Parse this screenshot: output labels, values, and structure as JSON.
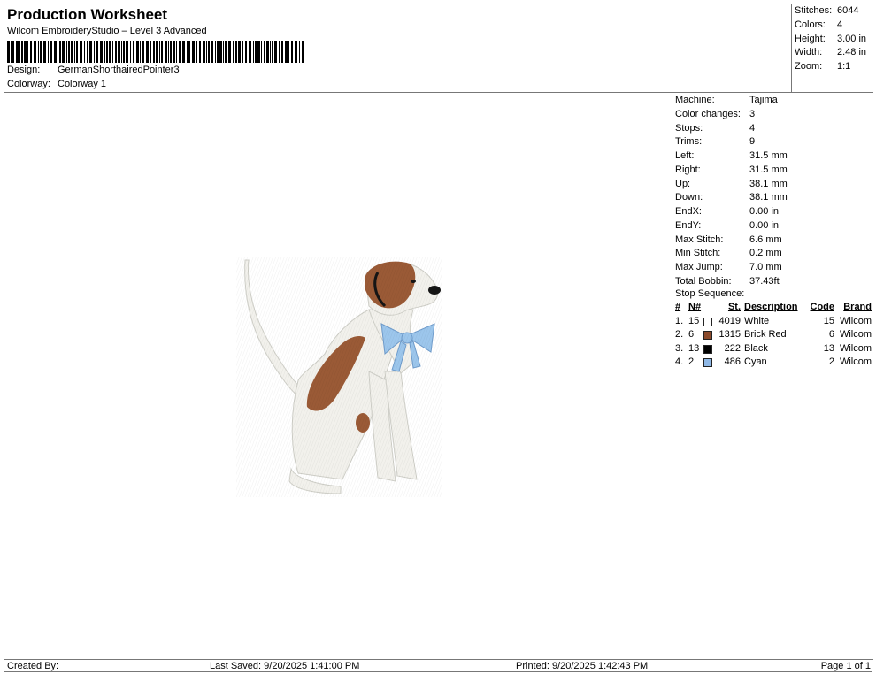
{
  "header": {
    "title": "Production Worksheet",
    "subtitle": "Wilcom EmbroideryStudio – Level 3 Advanced",
    "design_label": "Design:",
    "design_value": "GermanShorthairedPointer3",
    "colorway_label": "Colorway:",
    "colorway_value": "Colorway 1"
  },
  "stats": [
    {
      "label": "Stitches:",
      "value": "6044"
    },
    {
      "label": "Colors:",
      "value": "4"
    },
    {
      "label": "Height:",
      "value": "3.00 in"
    },
    {
      "label": "Width:",
      "value": "2.48 in"
    },
    {
      "label": "Zoom:",
      "value": "1:1"
    }
  ],
  "info": [
    {
      "label": "Machine:",
      "value": "Tajima"
    },
    {
      "label": "Color changes:",
      "value": "3"
    },
    {
      "label": "Stops:",
      "value": "4"
    },
    {
      "label": "Trims:",
      "value": "9"
    },
    {
      "label": "Left:",
      "value": "31.5 mm"
    },
    {
      "label": "Right:",
      "value": "31.5 mm"
    },
    {
      "label": "Up:",
      "value": "38.1 mm"
    },
    {
      "label": "Down:",
      "value": "38.1 mm"
    },
    {
      "label": "EndX:",
      "value": "0.00 in"
    },
    {
      "label": "EndY:",
      "value": "0.00 in"
    },
    {
      "label": "Max Stitch:",
      "value": "6.6 mm"
    },
    {
      "label": "Min Stitch:",
      "value": "0.2 mm"
    },
    {
      "label": "Max Jump:",
      "value": "7.0 mm"
    },
    {
      "label": "Total Bobbin:",
      "value": "37.43ft"
    }
  ],
  "sequence": {
    "title": "Stop Sequence:",
    "headers": {
      "num": "#",
      "n": "N#",
      "st": "St.",
      "desc": "Description",
      "code": "Code",
      "brand": "Brand"
    },
    "rows": [
      {
        "num": "1.",
        "n": "15",
        "color": "#ffffff",
        "st": "4019",
        "desc": "White",
        "code": "15",
        "brand": "Wilcom"
      },
      {
        "num": "2.",
        "n": "6",
        "color": "#8b4a2b",
        "st": "1315",
        "desc": "Brick Red",
        "code": "6",
        "brand": "Wilcom"
      },
      {
        "num": "3.",
        "n": "13",
        "color": "#000000",
        "st": "222",
        "desc": "Black",
        "code": "13",
        "brand": "Wilcom"
      },
      {
        "num": "4.",
        "n": "2",
        "color": "#8fb8e6",
        "st": "486",
        "desc": "Cyan",
        "code": "2",
        "brand": "Wilcom"
      }
    ]
  },
  "footer": {
    "created_by": "Created By:",
    "last_saved": "Last Saved: 9/20/2025 1:41:00 PM",
    "printed": "Printed: 9/20/2025 1:42:43 PM",
    "page": "Page 1 of 1"
  },
  "design_colors": {
    "white": "#f2f1ec",
    "brown": "#9a5a36",
    "black": "#151515",
    "cyan": "#9cc6ec"
  }
}
